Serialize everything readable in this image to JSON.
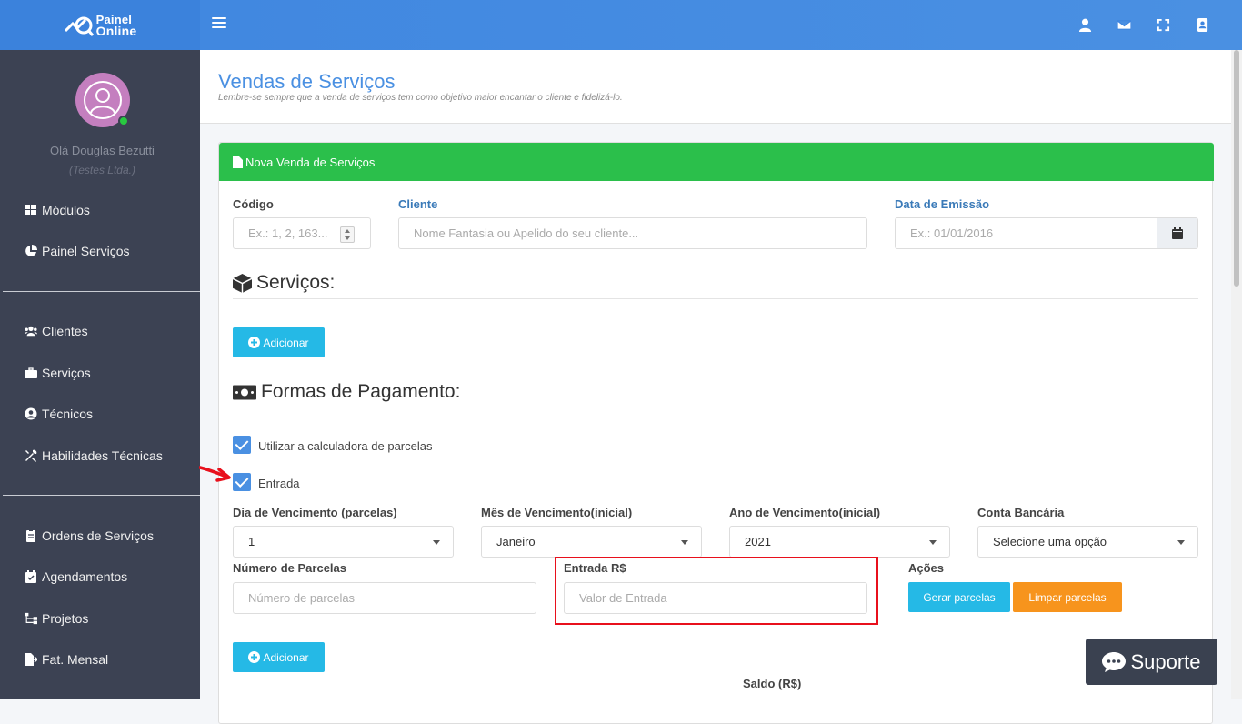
{
  "brand": {
    "line1": "Painel",
    "line2": "Online"
  },
  "user": {
    "greeting": "Olá Douglas Bezutti",
    "company": "(Testes Ltda.)"
  },
  "sidebar": {
    "items": [
      {
        "label": "Módulos",
        "icon": "grid-icon"
      },
      {
        "label": "Painel Serviços",
        "icon": "pie-chart-icon"
      },
      {
        "label": "Clientes",
        "icon": "users-icon"
      },
      {
        "label": "Serviços",
        "icon": "briefcase-icon"
      },
      {
        "label": "Técnicos",
        "icon": "user-circle-icon"
      },
      {
        "label": "Habilidades Técnicas",
        "icon": "tools-icon"
      },
      {
        "label": "Ordens de Serviços",
        "icon": "clipboard-icon"
      },
      {
        "label": "Agendamentos",
        "icon": "calendar-check-icon"
      },
      {
        "label": "Projetos",
        "icon": "sitemap-icon"
      },
      {
        "label": "Fat. Mensal",
        "icon": "file-export-icon"
      }
    ]
  },
  "page": {
    "title": "Vendas de Serviços",
    "subtitle": "Lembre-se sempre que a venda de serviços tem como objetivo maior encantar o cliente e fidelizá-lo."
  },
  "card": {
    "title": "Nova Venda de Serviços"
  },
  "form": {
    "codigo": {
      "label": "Código",
      "placeholder": "Ex.: 1, 2, 163..."
    },
    "cliente": {
      "label": "Cliente",
      "placeholder": "Nome Fantasia ou Apelido do seu cliente..."
    },
    "data_emissao": {
      "label": "Data de Emissão",
      "placeholder": "Ex.: 01/01/2016"
    },
    "servicos_title": "Serviços:",
    "add_label": "Adicionar",
    "pagamento_title": "Formas de Pagamento:",
    "check_calculadora": "Utilizar a calculadora de parcelas",
    "check_entrada": "Entrada",
    "dia_venc": {
      "label": "Dia de Vencimento (parcelas)",
      "value": "1"
    },
    "mes_venc": {
      "label": "Mês de Vencimento(inicial)",
      "value": "Janeiro"
    },
    "ano_venc": {
      "label": "Ano de Vencimento(inicial)",
      "value": "2021"
    },
    "conta": {
      "label": "Conta Bancária",
      "value": "Selecione uma opção"
    },
    "num_parcelas": {
      "label": "Número de Parcelas",
      "placeholder": "Número de parcelas"
    },
    "entrada": {
      "label": "Entrada R$",
      "placeholder": "Valor de Entrada"
    },
    "acoes": {
      "label": "Ações",
      "gerar": "Gerar parcelas",
      "limpar": "Limpar parcelas"
    },
    "add2_label": "Adicionar",
    "saldo_label": "Saldo (R$)"
  },
  "support": {
    "label": "Suporte"
  },
  "colors": {
    "header": "#4a90e2",
    "sidebar": "#3c4253",
    "card_head": "#2bbf4b",
    "info": "#25b9e6",
    "warning": "#f7941d",
    "highlight": "#e8101c"
  }
}
